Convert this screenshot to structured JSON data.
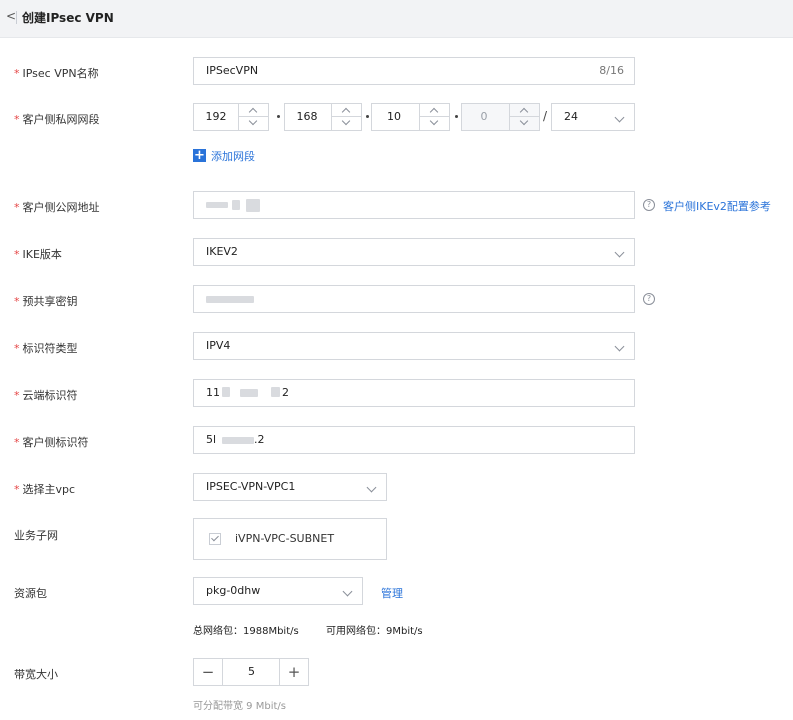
{
  "header": {
    "back_icon": "chevron-left-icon",
    "back_glyph": "<",
    "title": "创建IPsec VPN"
  },
  "required_mark": "*",
  "fields": {
    "vpn_name": {
      "label": "IPsec VPN名称",
      "value": "IPSecVPN",
      "counter": "8/16"
    },
    "client_private_segment": {
      "label": "客户侧私网网段",
      "octets": [
        "192",
        "168",
        "10",
        "0"
      ],
      "last_octet_disabled": true,
      "separator": "/",
      "prefix": "24",
      "add_label": "添加网段",
      "add_glyph": "+"
    },
    "client_public_ip": {
      "label": "客户侧公网地址",
      "help_link": "客户侧IKEv2配置参考"
    },
    "ike_version": {
      "label": "IKE版本",
      "value": "IKEV2"
    },
    "pre_shared_key": {
      "label": "预共享密钥"
    },
    "identifier_type": {
      "label": "标识符类型",
      "value": "IPV4"
    },
    "cloud_identifier": {
      "label": "云端标识符",
      "value_prefix": "11",
      "value_suffix": "2"
    },
    "client_identifier": {
      "label": "客户侧标识符",
      "value_prefix": "5l",
      "value_suffix": ".2"
    },
    "main_vpc": {
      "label": "选择主vpc",
      "value": "IPSEC-VPN-VPC1"
    },
    "business_subnet": {
      "label": "业务子网",
      "option": "iVPN-VPC-SUBNET",
      "checked": true
    },
    "resource_package": {
      "label": "资源包",
      "value": "pkg-0dhw",
      "manage_label": "管理",
      "total_label": "总网络包：",
      "total_value": "1988Mbit/s",
      "available_label": "可用网络包：",
      "available_value": "9Mbit/s"
    },
    "bandwidth": {
      "label": "带宽大小",
      "value": "5",
      "minus_glyph": "−",
      "plus_glyph": "+",
      "hint": "可分配带宽 9 Mbit/s"
    }
  },
  "icons": {
    "help": "question-circle-icon",
    "help_glyph": "?",
    "dropdown": "chevron-down-icon",
    "add": "plus-square-icon"
  },
  "colors": {
    "accent": "#2a73d9",
    "required": "#e54545",
    "border": "#d4d7dc",
    "header_bg": "#f2f3f5"
  }
}
